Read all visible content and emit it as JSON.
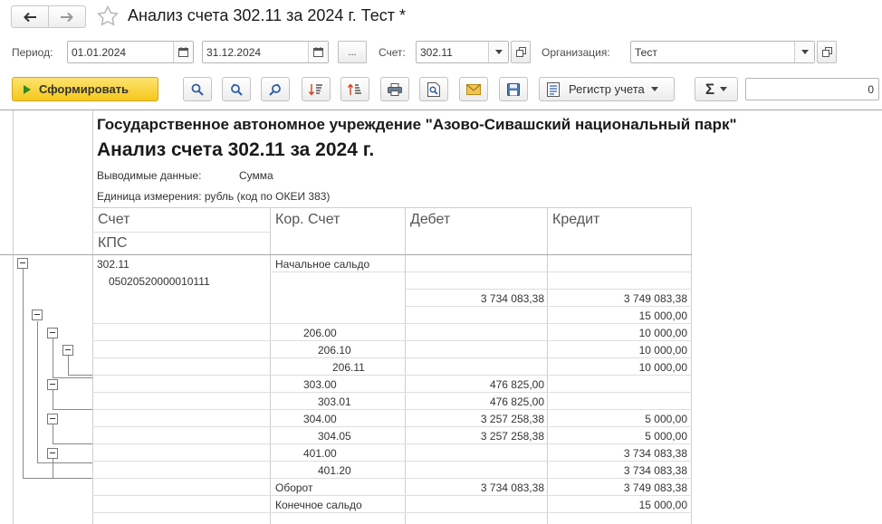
{
  "window": {
    "title": "Анализ счета 302.11 за 2024 г. Тест *"
  },
  "params": {
    "period_label": "Период:",
    "date_from": "01.01.2024",
    "date_to": "31.12.2024",
    "period_more": "...",
    "account_label": "Счет:",
    "account": "302.11",
    "org_label": "Организация:",
    "org": "Тест"
  },
  "toolbar": {
    "generate_label": "Сформировать",
    "register_label": "Регистр учета",
    "sum_label": "Σ",
    "sum_value": "0"
  },
  "report": {
    "org_name": "Государственное автономное учреждение \"Азово-Сивашский национальный парк\"",
    "title": "Анализ счета 302.11 за 2024 г.",
    "output_label": "Выводимые данные:",
    "output_value": "Сумма",
    "unit": "Единица измерения: рубль (код по ОКЕИ 383)",
    "headers": {
      "account": "Счет",
      "kps": "КПС",
      "corr": "Кор. Счет",
      "debit": "Дебет",
      "credit": "Кредит"
    },
    "account": "302.11",
    "kps": "05020520000010111",
    "rows": [
      {
        "corr": "Начальное сальдо",
        "debit": "",
        "credit": ""
      },
      {
        "corr": "",
        "debit": "",
        "credit": ""
      },
      {
        "corr": "",
        "debit": "3 734 083,38",
        "credit": "3 749 083,38"
      },
      {
        "corr": "",
        "debit": "",
        "credit": "15 000,00"
      },
      {
        "corr": "206.00",
        "debit": "",
        "credit": "10 000,00"
      },
      {
        "corr": "206.10",
        "debit": "",
        "credit": "10 000,00"
      },
      {
        "corr": "206.11",
        "debit": "",
        "credit": "10 000,00"
      },
      {
        "corr": "303.00",
        "debit": "476 825,00",
        "credit": ""
      },
      {
        "corr": "303.01",
        "debit": "476 825,00",
        "credit": ""
      },
      {
        "corr": "304.00",
        "debit": "3 257 258,38",
        "credit": "5 000,00"
      },
      {
        "corr": "304.05",
        "debit": "3 257 258,38",
        "credit": "5 000,00"
      },
      {
        "corr": "401.00",
        "debit": "",
        "credit": "3 734 083,38"
      },
      {
        "corr": "401.20",
        "debit": "",
        "credit": "3 734 083,38"
      },
      {
        "corr": "Оборот",
        "debit": "3 734 083,38",
        "credit": "3 749 083,38"
      },
      {
        "corr": "Конечное сальдо",
        "debit": "",
        "credit": "15 000,00"
      }
    ]
  }
}
